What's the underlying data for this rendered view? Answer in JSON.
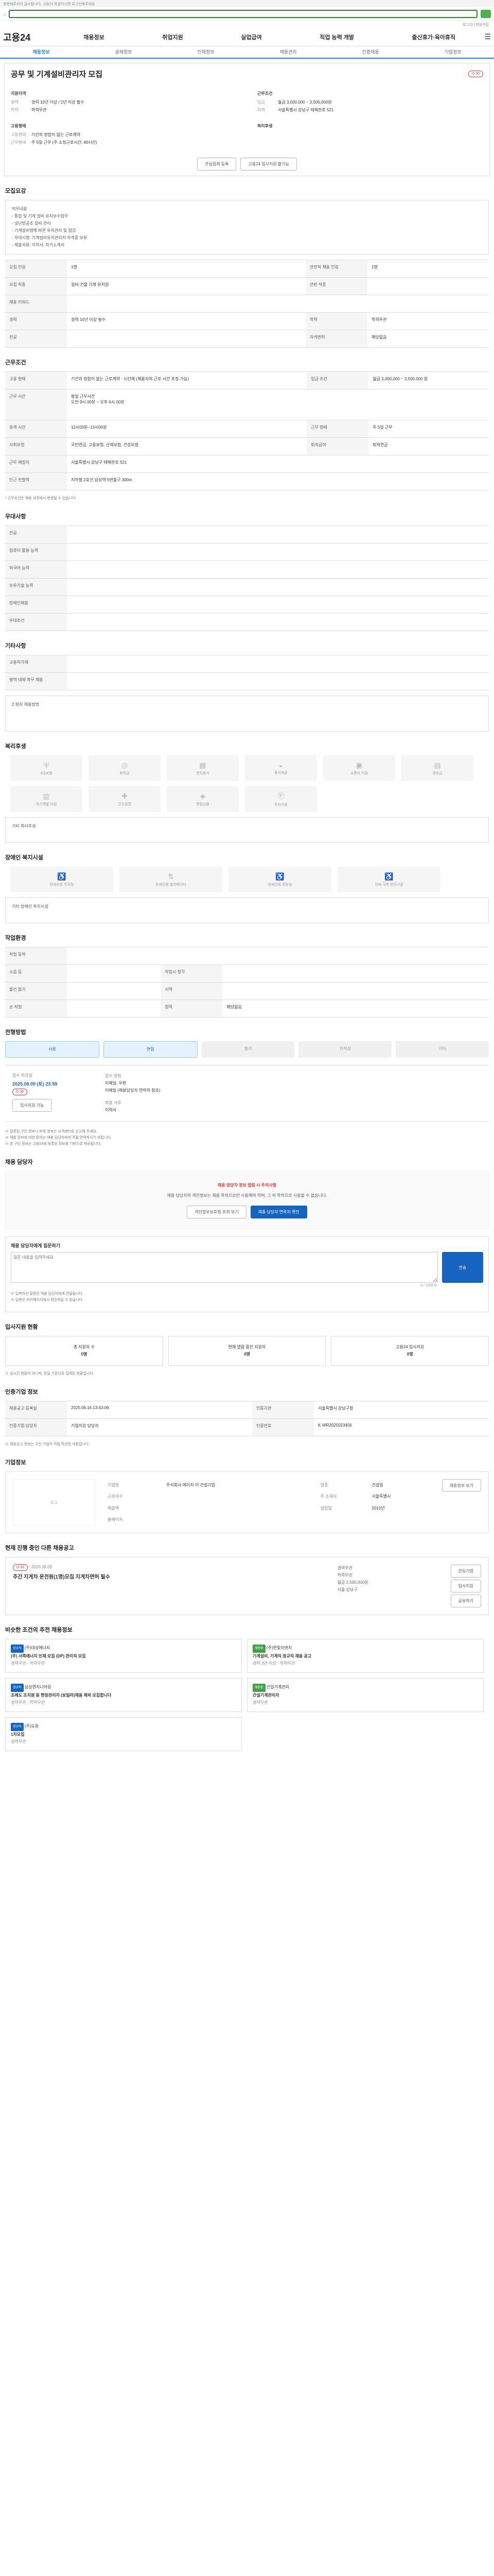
{
  "browser": {
    "notice": "방문해주셔서 감사합니다. 고용24 회원이시면 로그인해주세요",
    "util": "로그인 | 회원가입"
  },
  "header": {
    "logo": "고용24",
    "menu": [
      "채용정보",
      "취업지원",
      "실업급여",
      "직업 능력 개발",
      "출산휴가·육아휴직"
    ]
  },
  "subtabs": [
    "채용정보",
    "공채정보",
    "인재정보",
    "채용관리",
    "인증채용",
    "기업정보"
  ],
  "title": {
    "text": "공무 및 기계설비관리자 모집",
    "badge": "D-30",
    "left_heading": "지원자격",
    "left": [
      [
        "경력",
        "경력 10년 이상 / 2년 이상 필수"
      ],
      [
        "학력",
        "학력무관"
      ]
    ],
    "right_heading": "근무조건",
    "right": [
      [
        "임금",
        "월급 3,000,000 ~ 3,500,000원"
      ],
      [
        "지역",
        "서울특별시 강남구 테헤란로 521"
      ]
    ],
    "left2_heading": "고용형태",
    "left2": [
      [
        "고용형태",
        "기간의 정함이 없는 근로계약"
      ],
      [
        "근무형태",
        "주 5일 근무 (주 소정근로시간: 40시간)"
      ]
    ],
    "right2_heading": "복리후생",
    "btn_apply": "관심업체 등록",
    "btn_share": "고용24 입사지원 불가능"
  },
  "jobdesc": {
    "heading": "모집요강",
    "box": [
      "직무내용",
      "- 통합 및 기계 설비 유지보수업무",
      "- 냉난방공조 설비 관리",
      "- 기계설비법에 따른 유지관리 및 점검",
      "- 우대사항: 기계설비유지관리자 자격증 보유",
      "- 제출서류: 이력서, 자기소개서"
    ]
  },
  "detail_rows": [
    [
      "모집 인원",
      "1명",
      "관련직 채용 인원",
      "1명"
    ],
    [
      "모집 직종",
      "설비·건물 기계 유지원",
      "관련 직종",
      ""
    ],
    [
      "채용 키워드",
      "",
      "",
      ""
    ],
    [
      "경력",
      "경력 10년 이상 필수",
      "학력",
      "학력무관"
    ],
    [
      "전공",
      "",
      "자격면허",
      "해당없음"
    ]
  ],
  "conditions": {
    "heading": "근무조건",
    "rows": [
      [
        "고용 형태",
        "기간의 정함이 없는 근로계약 · 시간제 (채용자의 근로 시간 조정 가능)",
        "임금 조건",
        "월급 3,000,000 ~ 3,500,000 원"
      ],
      [
        "근무 시간",
        "평일 근무시간\n오전 9시 00분 ~ 오후 6시 00분",
        "",
        ""
      ],
      [
        "휴게 시간",
        "12시00분~13시00분",
        "근무 형태",
        "주 5일 근무"
      ],
      [
        "사회보험",
        "국민연금, 고용보험, 산재보험, 건강보험",
        "퇴직급여",
        "퇴직연금"
      ],
      [
        "근무 예정지",
        "서울특별시 강남구 테헤란로 521",
        "",
        ""
      ],
      [
        "인근 전철역",
        "지하철 2호선 삼성역 5번출구 300m",
        "",
        ""
      ]
    ],
    "note": "* 근무조건은 채용 과정에서 변경될 수 있습니다."
  },
  "prefer": {
    "heading": "우대사항",
    "rows": [
      "전공",
      "컴퓨터 활용 능력",
      "외국어 능력",
      "보유기술 능력",
      "장애인채용",
      "우대조건"
    ]
  },
  "etc": {
    "heading": "기타사항",
    "rows": [
      "고용허가제",
      "병역 대체 복무 채용"
    ],
    "box": "2 회차 채용방법"
  },
  "welfare": {
    "heading": "복리후생",
    "items": [
      "4대보험",
      "퇴직금",
      "연차휴가",
      "중식제공",
      "교통비 지원",
      "경조금",
      "자기계발 지원",
      "건강검진",
      "명절선물",
      "주차지원"
    ],
    "box": "기타 복리후생"
  },
  "disability": {
    "heading": "장애인 복지시설",
    "items": [
      "장애인용 주차장",
      "장애인용 엘리베이터",
      "장애인용 화장실",
      "장애 극복 편의시설"
    ],
    "box": "기타 장애인 복지시설"
  },
  "workenv": {
    "heading": "작업환경",
    "rows": [
      [
        "작업 동작",
        "",
        "",
        ""
      ],
      [
        "소음 등",
        "",
        "작업시 청각",
        ""
      ],
      [
        "물건 들기",
        "",
        "시력",
        ""
      ],
      [
        "손 작업",
        "",
        "청력",
        "해당없음"
      ]
    ]
  },
  "recruit": {
    "heading": "전형방법",
    "opts": [
      "서류",
      "면접",
      "필기",
      "인적성",
      "기타"
    ],
    "deadline_label": "접수 마감일",
    "deadline": "2025.08.09 (토) 23:59",
    "dday": "D-30",
    "apply_label": "접수 방법",
    "apply_methods": "이메일, 우편",
    "apply_note": "이메일 (채용담당자 연락처 참조)",
    "docs_label": "제출 서류",
    "docs": "이력서",
    "submit_btn": "입사지원 가능",
    "notes": [
      "※ 잘못된 구인 정보나 허위 정보는 고객센터로 신고해 주세요.",
      "※ 채용 정보에 대한 문의는 채용 담당자에게 직접 연락하시기 바랍니다.",
      "※ 본 구인 정보는 고용24에 등록된 정보를 기반으로 제공됩니다."
    ]
  },
  "contact": {
    "heading": "채용 담당자",
    "notice": "채용 담당자 정보 열람 시 주의사항",
    "desc": "채용 담당자의 개인정보는 채용 목적으로만 사용해야 하며, 그 외 목적으로 사용할 수 없습니다.",
    "btn1": "개인정보보호법 조회 보기",
    "btn2": "채용 담당자 연락처 확인",
    "qa_heading": "채용 담당자에게 질문하기",
    "qa_placeholder": "질문 내용을 입력하세요",
    "qa_btn": "전송",
    "qa_count": "0 / 1000자",
    "qa_notes": [
      "※ 입력하신 질문은 채용 담당자에게 전달됩니다.",
      "※ 답변은 마이페이지에서 확인하실 수 있습니다."
    ]
  },
  "stats": {
    "heading": "입사지원 현황",
    "cards": [
      [
        "총 지원자 수",
        "0명"
      ],
      [
        "현재 열람 중인 지원자",
        "0명"
      ],
      [
        "고용24 입사지원",
        "0명"
      ]
    ],
    "note": "※ 실시간 현황이 아니며, 전일 기준으로 집계된 현황입니다."
  },
  "company": {
    "heading": "인증기업 정보",
    "rows": [
      [
        "채용공고 등록일",
        "2025.06.16 13:43:06",
        "인증기관",
        "서울특별시 강남구청"
      ],
      [
        "인증기업 담당자",
        "기업지원 담당자",
        "인증번호",
        "K-WR2025023456"
      ]
    ],
    "notes": [
      "※ 채용공고 정보는 구인 기업이 직접 작성한 내용입니다."
    ]
  },
  "corpinfo": {
    "heading": "기업정보",
    "logo": "로고",
    "btn": "채용정보 보기",
    "rows": [
      [
        "기업명",
        "주식회사 에이치 이 건설기업",
        "업종",
        "건설업"
      ],
      [
        "근로자수",
        "",
        "주 소재지",
        "서울특별시"
      ],
      [
        "매출액",
        "",
        "설립일",
        "2010년"
      ],
      [
        "홈페이지",
        "",
        "",
        ""
      ]
    ]
  },
  "similar": {
    "heading": "현재 진행 중인 다른 채용공고",
    "dday": "D-30",
    "date": "~2025.08.09",
    "title": "주간 지게차 운전원(1명)모집 지게차면허 필수",
    "info": [
      "경력무관",
      "학력무관",
      "월급 2,500,000원",
      "서울 강남구"
    ],
    "btns": [
      "관심기업",
      "입사지원",
      "공유하기"
    ]
  },
  "recommend": {
    "heading": "비슷한 조건의 추천 채용정보",
    "items": [
      {
        "tag": "정규직",
        "company": "(주)대성에너지",
        "title": "(주) 서쪽에너지 인재 모집 (DP) 관리직 모집",
        "meta": "경력무관 · 학력무관"
      },
      {
        "tag": "채용중",
        "company": "(주)한빛이엔지",
        "title": "기계설비, 기계직 정규직 채용 공고",
        "meta": "경력 3년 이상 · 학력무관"
      },
      {
        "tag": "정규직",
        "company": "삼성엔지니어링",
        "title": "조례도 조치원 등 현장관리자 (보일러)채용 제외 모집합니다",
        "meta": "경력무관 · 학력무관"
      },
      {
        "tag": "채용중",
        "company": "건설기계관리",
        "title": "건설기계관리자",
        "meta": "경력무관"
      },
      {
        "tag": "정규직",
        "company": "(주)도원",
        "title": "1차모집",
        "meta": "경력무관"
      }
    ]
  }
}
